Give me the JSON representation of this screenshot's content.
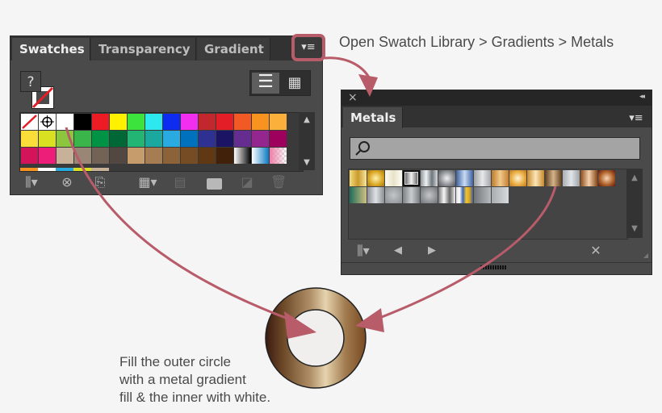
{
  "swatches_panel": {
    "tabs": [
      {
        "label": "Swatches",
        "active": true
      },
      {
        "label": "Transparency",
        "active": false
      },
      {
        "label": "Gradient",
        "active": false
      }
    ],
    "menu_icon": "panel-menu-icon",
    "fill_stroke": {
      "fill_label": "?"
    },
    "view_buttons": [
      "list-view-icon",
      "thumbnail-view-icon"
    ],
    "swatch_rows": [
      [
        "none",
        "registration",
        "#ffffff",
        "#000000",
        "#ed1c24",
        "#fff200",
        "#3de33d",
        "#2ee8f0",
        "#0d2cf0",
        "#f22ef0",
        "#c1272d",
        "#e31e26",
        "#f15a24",
        "#f7931e",
        "#fbb03b"
      ],
      [
        "#fbdd3a",
        "#d9e021",
        "#8cc63f",
        "#39b54a",
        "#009245",
        "#006837",
        "#22b573",
        "#1aa89f",
        "#29abe2",
        "#0071bc",
        "#2e3192",
        "#1b1464",
        "#662d91",
        "#93278f",
        "#9e005d"
      ],
      [
        "#d4145a",
        "#ed1e79",
        "#c7b299",
        "#998675",
        "#736357",
        "#534741",
        "#c69c6d",
        "#a67c52",
        "#8c6239",
        "#754c24",
        "#603813",
        "#42210b",
        "grad-bw",
        "grad-blue",
        "grad-pink-checker"
      ]
    ],
    "footer_icons": [
      "swatch-libraries-icon",
      "place-swatches-icon",
      "save-swatch-library-icon",
      "show-swatch-kinds-icon",
      "swatch-options-icon",
      "new-color-group-icon",
      "new-swatch-icon",
      "delete-swatch-icon"
    ]
  },
  "metals_panel": {
    "close_label": "×",
    "collapse_label": "◂◂",
    "tab_label": "Metals",
    "search": {
      "value": "",
      "placeholder": ""
    },
    "swatch_rows": [
      [
        "linear-gradient(90deg,#f5dc7a,#c99a2e,#f7e7a0)",
        "radial-gradient(circle,#fff3b0,#d9a522 60%,#a07415)",
        "linear-gradient(90deg,#fffdf0,#e8e2c9,#fffef5)",
        "linear-gradient(90deg,#5a5a5a,#f2f2f2,#5a5a5a)",
        "linear-gradient(90deg,#8e959a,#eef2f4,#6e767b,#d5dade)",
        "radial-gradient(circle,#f0f0f0,#8a8f93 60%,#555)",
        "linear-gradient(90deg,#3d5f9a,#c9dcf5,#3f62a0)",
        "linear-gradient(90deg,#9da0a3,#e6e8e9,#a4a7aa)",
        "linear-gradient(90deg,#b97a2c,#f3c98a,#c28135)",
        "radial-gradient(circle,#fff5d6,#e9a93c 60%,#b9782a)",
        "linear-gradient(90deg,#c98a2e,#fbe6b7,#c8892d)",
        "linear-gradient(90deg,#5b3d1e,#d6b48a,#5a3c1d)",
        "linear-gradient(90deg,#a9aeb3,#e2e5e8,#9ea3a8)",
        "linear-gradient(90deg,#8b4a1a,#f4d1ae,#874717)",
        "radial-gradient(circle,#f7d6b7,#b2642c 55%,#5e160e)"
      ],
      [
        "linear-gradient(90deg,#1e6b5a,#d2c183)",
        "linear-gradient(90deg,#8b8f93,#dfe2e5,#8a8e92)",
        "radial-gradient(circle,#c2c5c8,#8b8f93)",
        "linear-gradient(90deg,#7d8185,#c9cdd0,#7a7e82)",
        "radial-gradient(circle,#c3c7ca,#6e7276)",
        "linear-gradient(90deg,#777,#f7f7f7,#666,#eee)",
        "linear-gradient(90deg,#ddd,#fff 20%,#3b67b0 40%,#f2c530 60%,#cfa22a 80%,#3f5f9f)",
        "linear-gradient(90deg,#6f7478,#b8bcbf)",
        "linear-gradient(90deg,#a8acb0,#d8dbdd)"
      ]
    ],
    "footer_icons": [
      "swatch-libraries-icon",
      "previous-library-icon",
      "next-library-icon",
      "add-to-swatches-icon"
    ]
  },
  "annotations": {
    "top_instruction": "Open Swatch Library > Gradients > Metals",
    "bottom_instruction": [
      "Fill the outer circle",
      "with a metal gradient",
      "fill & the inner with white."
    ],
    "arrow_color": "#b85c6a"
  }
}
